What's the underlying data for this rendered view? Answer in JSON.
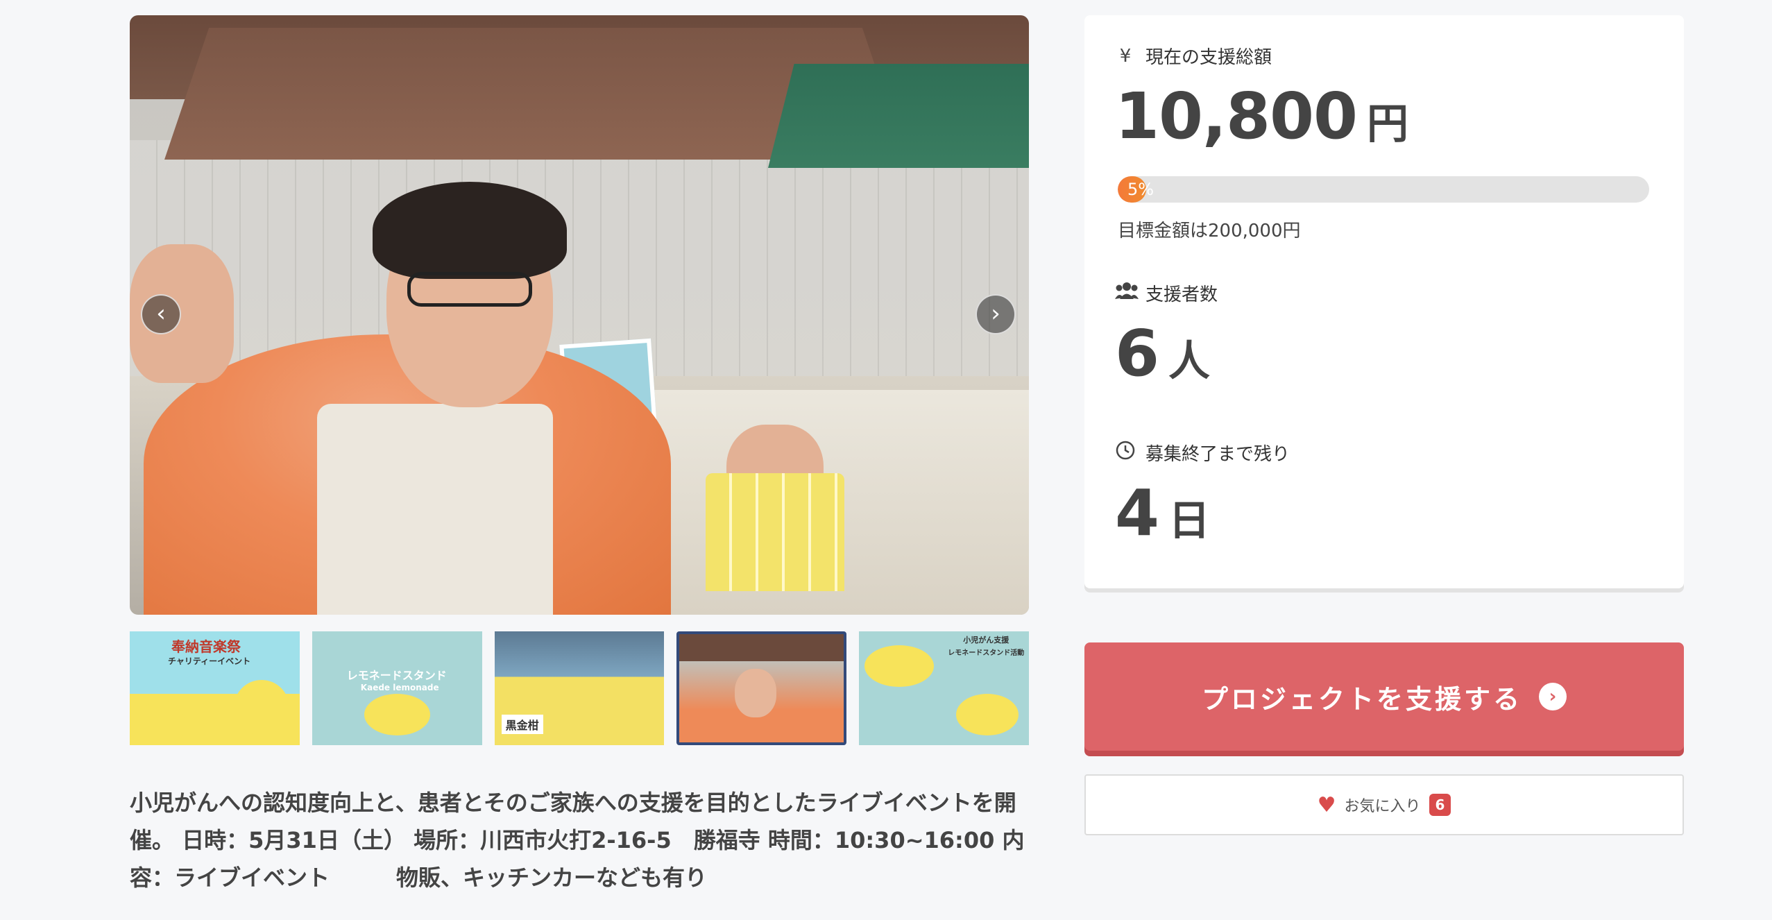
{
  "gallery": {
    "prev_label": "‹",
    "next_label": "›",
    "thumbnails": [
      {
        "name": "thumbnail-1",
        "text_a": "奉納音楽祭",
        "text_b": "チャリティーイベント"
      },
      {
        "name": "thumbnail-2",
        "text_a": "レモネードスタンド",
        "text_b": "Kaede lemonade"
      },
      {
        "name": "thumbnail-3",
        "text_a": "黒金柑",
        "text_b": ""
      },
      {
        "name": "thumbnail-4",
        "text_a": "",
        "text_b": ""
      },
      {
        "name": "thumbnail-5",
        "text_a": "小児がん支援",
        "text_b": "レモネードスタンド活動"
      }
    ]
  },
  "description": "小児がんへの認知度向上と、患者とそのご家族への支援を目的としたライブイベントを開催。 日時：5月31日（土） 場所：川西市火打2-16-5　勝福寺 時間：10:30~16:00 内容：ライブイベント　　　物販、キッチンカーなども有り",
  "stats": {
    "total": {
      "icon": "yen-icon",
      "label": "現在の支援総額",
      "value": "10,800",
      "unit": "円"
    },
    "progress": {
      "percent_text": "5%",
      "fraction": 0.054,
      "goal_text": "目標金額は200,000円"
    },
    "supporters": {
      "icon": "users-icon",
      "label": "支援者数",
      "value": "6",
      "unit": "人"
    },
    "remaining": {
      "icon": "clock-icon",
      "label": "募集終了まで残り",
      "value": "4",
      "unit": "日"
    }
  },
  "actions": {
    "support_label": "プロジェクトを支援する",
    "support_arrow": "›",
    "favorite_label": "お気に入り",
    "favorite_count": "6"
  },
  "colors": {
    "support_button": "#dd6468",
    "progress_fill": "#f47a3a",
    "heart": "#d94b4b",
    "active_thumb_border": "#334a7a"
  }
}
